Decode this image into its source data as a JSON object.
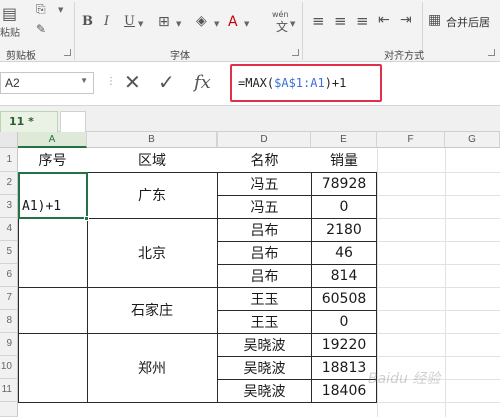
{
  "ribbon": {
    "clipboard_label": "剪贴板",
    "font_label": "字体",
    "align_label": "对齐方式",
    "paste_label": "粘贴",
    "bold": "B",
    "italic": "I",
    "underline": "U",
    "merge_label": "合并后居",
    "wen_label": "wén"
  },
  "formula_bar": {
    "name_box": "A2",
    "cancel": "✕",
    "confirm": "✓",
    "fx": "fx",
    "formula_prefix": "=MAX(",
    "formula_ref": "$A$1:A1",
    "formula_suffix": ")+1"
  },
  "sheet": {
    "tab_label": "11 *"
  },
  "columns": [
    "A",
    "B",
    "",
    "D",
    "E",
    "F",
    "G"
  ],
  "rows": [
    "1",
    "2",
    "3",
    "4",
    "5",
    "6",
    "7",
    "8",
    "9",
    "10",
    "11"
  ],
  "table": {
    "headers": [
      "序号",
      "区域",
      "名称",
      "销量"
    ],
    "editing_cell": "A1)+1",
    "regions": [
      "广东",
      "北京",
      "石家庄",
      "郑州"
    ],
    "names": [
      "冯五",
      "冯五",
      "吕布",
      "吕布",
      "吕布",
      "王玉",
      "王玉",
      "吴晓波",
      "吴晓波",
      "吴晓波"
    ],
    "sales": [
      "78928",
      "0",
      "2180",
      "46",
      "814",
      "60508",
      "0",
      "19220",
      "18813",
      "18406"
    ]
  },
  "watermark": "Baidu 经验"
}
